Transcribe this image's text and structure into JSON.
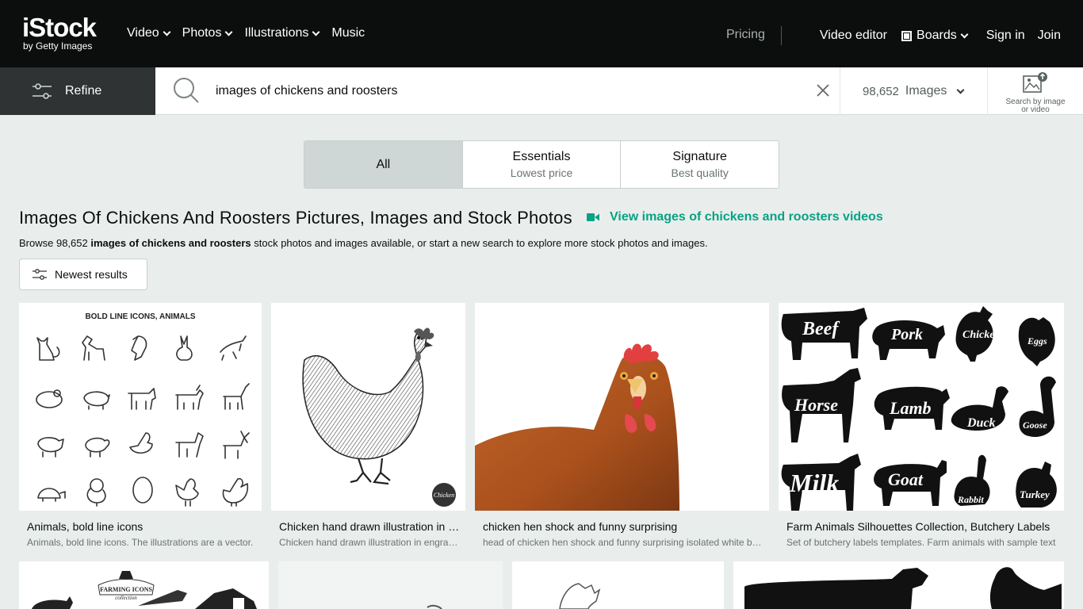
{
  "brand": {
    "logo": "iStock",
    "sub": "by Getty Images"
  },
  "nav": {
    "left": [
      {
        "label": "Video",
        "dropdown": true
      },
      {
        "label": "Photos",
        "dropdown": true
      },
      {
        "label": "Illustrations",
        "dropdown": true
      },
      {
        "label": "Music",
        "dropdown": false
      }
    ],
    "pricing": "Pricing",
    "video_editor": "Video editor",
    "boards": "Boards",
    "sign_in": "Sign in",
    "join": "Join"
  },
  "search": {
    "refine_label": "Refine",
    "query": "images of chickens and roosters",
    "result_count": "98,652",
    "result_type": "Images",
    "image_search_label": "Search by image or video"
  },
  "tabs": [
    {
      "title": "All",
      "subtitle": "",
      "active": true
    },
    {
      "title": "Essentials",
      "subtitle": "Lowest price",
      "active": false
    },
    {
      "title": "Signature",
      "subtitle": "Best quality",
      "active": false
    }
  ],
  "heading": "Images Of Chickens And Roosters Pictures, Images and Stock Photos",
  "video_link": "View images of chickens and roosters videos",
  "browse": {
    "prefix": "Browse 98,652 ",
    "bold": "images of chickens and roosters",
    "suffix": " stock photos and images available, or start a new search to explore more stock photos and images."
  },
  "sort_label": "Newest results",
  "results": [
    {
      "title": "Animals, bold line icons",
      "desc": "Animals, bold line icons. The illustrations are a vector.",
      "image_caption": "BOLD LINE ICONS, ANIMALS"
    },
    {
      "title": "Chicken hand drawn illustration in engraved style",
      "desc": "Chicken hand drawn illustration in engraved style",
      "image_caption": "Chicken"
    },
    {
      "title": "chicken hen shock and funny surprising",
      "desc": "head of chicken hen shock and funny surprising isolated white background",
      "image_caption": ""
    },
    {
      "title": "Farm Animals Silhouettes Collection, Butchery Labels",
      "desc": "Set of butchery labels templates. Farm animals with sample text",
      "image_caption": ""
    }
  ],
  "farm_labels": [
    "Beef",
    "Pork",
    "Chicken",
    "Eggs",
    "Horse",
    "Lamb",
    "Duck",
    "Goose",
    "Milk",
    "Goat",
    "Rabbit",
    "Turkey"
  ],
  "second_row_caption": "FARMING ICONS",
  "second_row_caption2": "collection",
  "colors": {
    "accent": "#08a283",
    "nav_bg": "#0c0d0d",
    "refine_bg": "#2f3333",
    "page_bg": "#e9eeed"
  }
}
